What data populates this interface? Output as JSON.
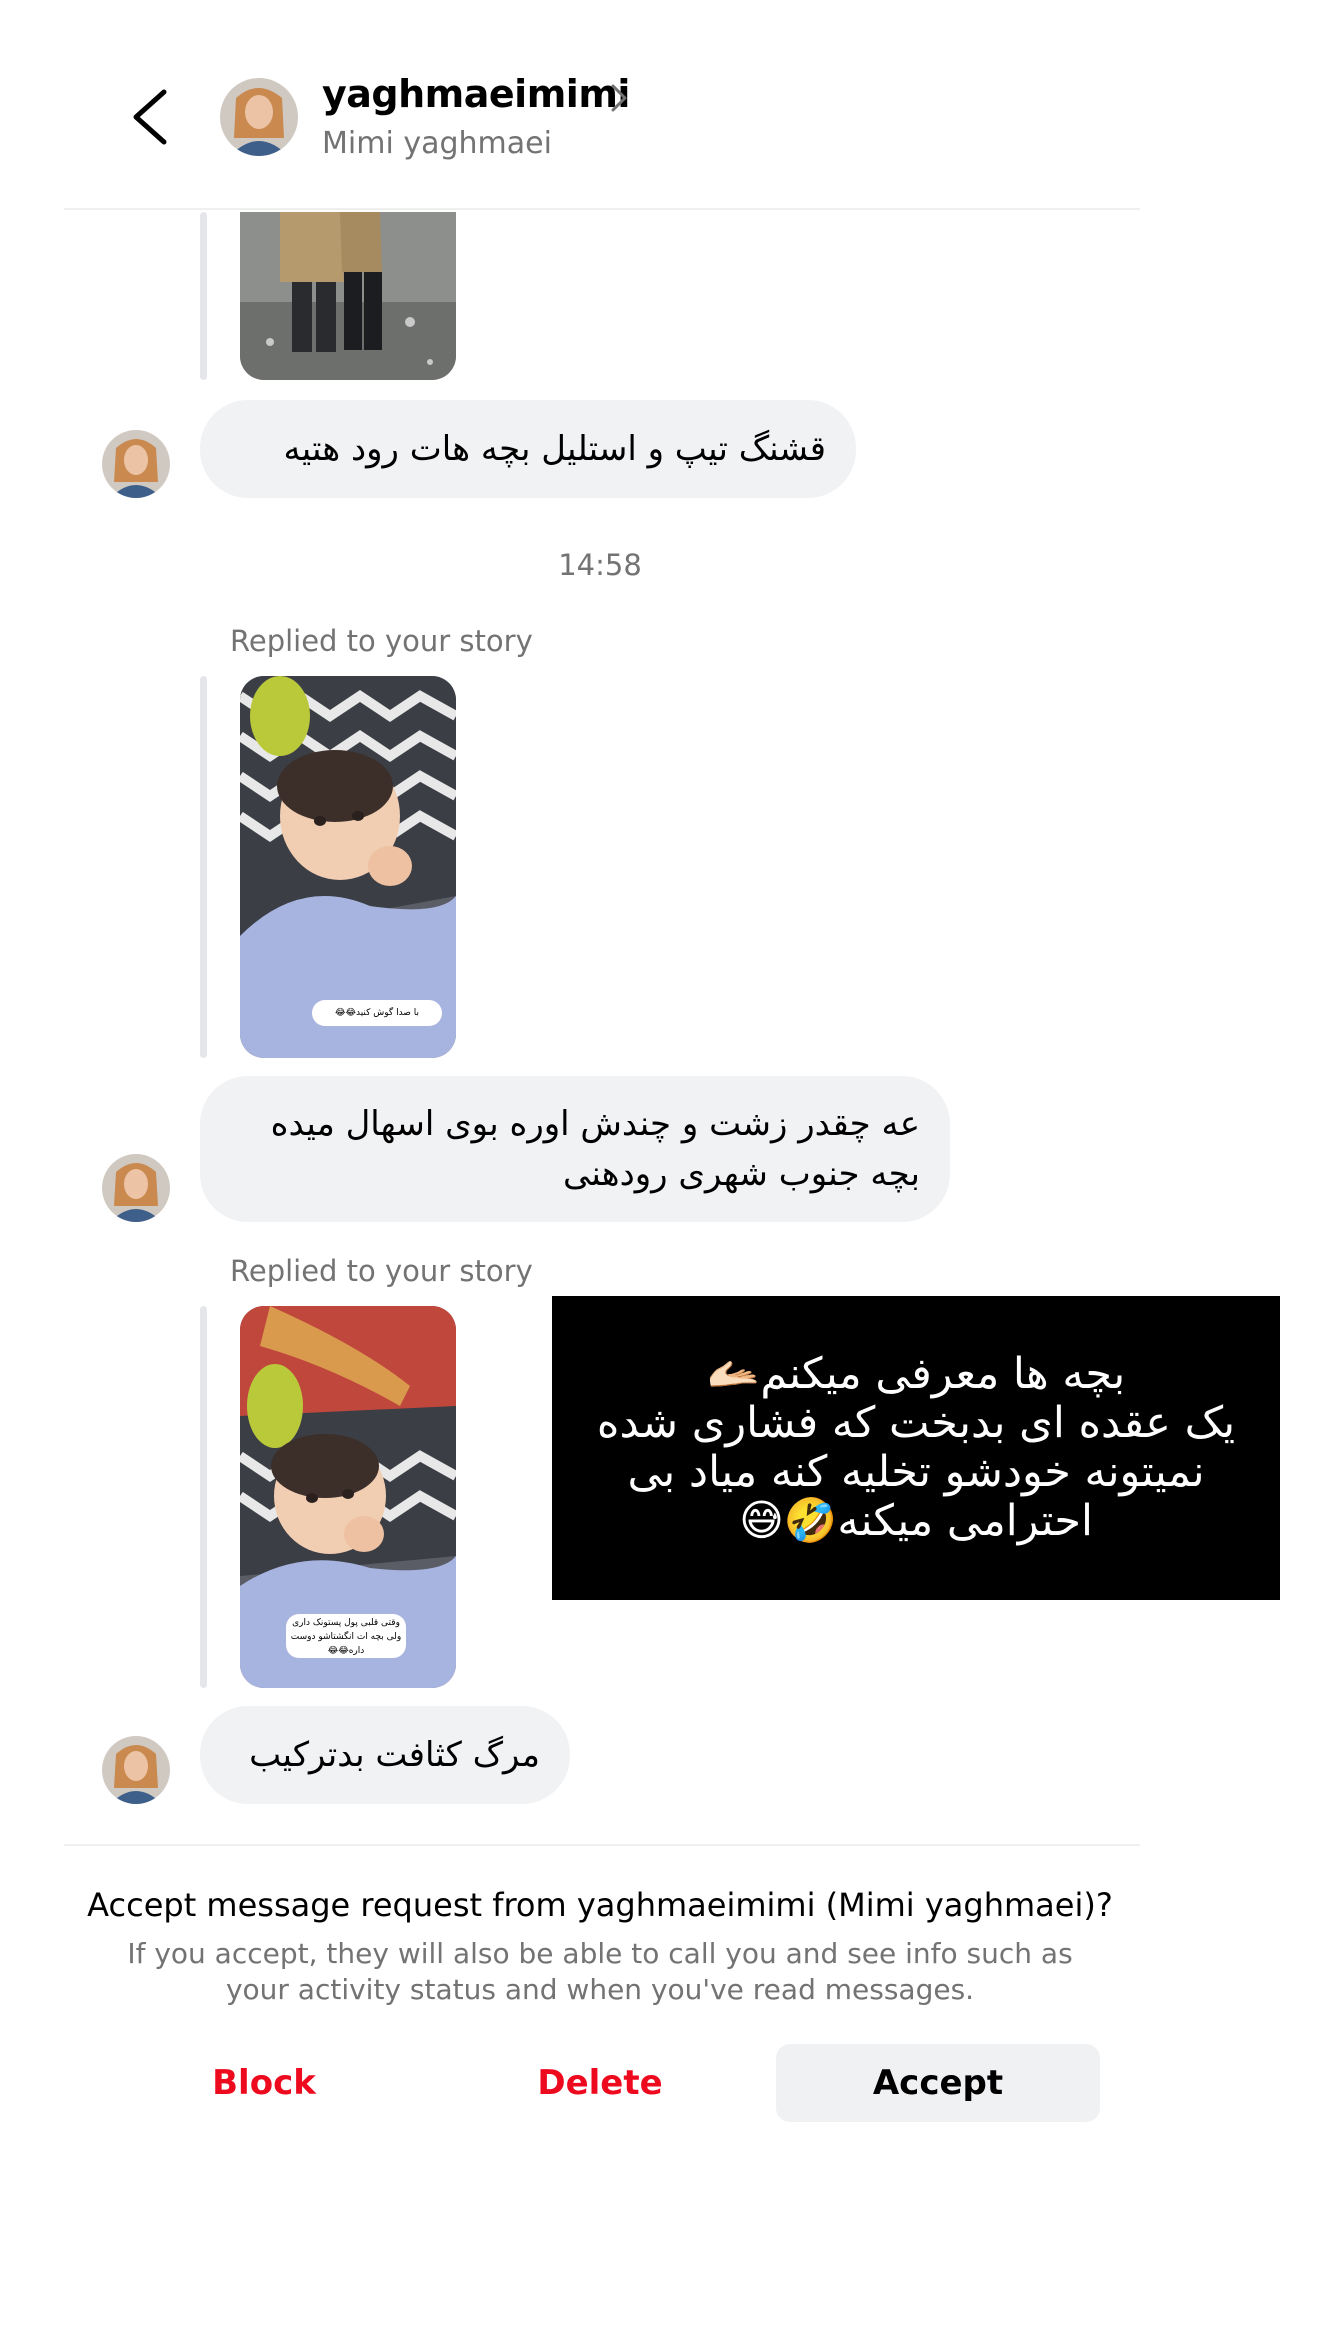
{
  "header": {
    "username": "yaghmaeimimi",
    "full_name": "Mimi yaghmaei"
  },
  "thread": {
    "message_1": "قشنگ تیپ و استلیل بچه هات رود هتیه",
    "timestamp": "14:58",
    "reply_1": {
      "label": "Replied to your story",
      "sticker": "با صدا گوش کنید😂😂",
      "message_line_1": "عه چقدر زشت و چندش اوره بوی اسهال میده",
      "message_line_2": "بچه جنوب شهری رودهنی"
    },
    "reply_2": {
      "label": "Replied to your story",
      "sticker": "وقتی قلبی پول پستونک داری ولی بچه ات انگشتاشو دوست داره😂😂",
      "message": "مرگ کثافت بدترکیب"
    },
    "overlay_caption": {
      "line_1": "بچه ها معرفی میکنم🫴🏻",
      "line_2": "یک عقده ای بدبخت که فشاری شده",
      "line_3": "نمیتونه خودشو تخلیه کنه میاد بی",
      "line_4": "احترامی میکنه🤣😅"
    }
  },
  "request": {
    "title": "Accept message request from yaghmaeimimi (Mimi yaghmaei)?",
    "description": "If you accept, they will also be able to call you and see info such as your activity status and when you've read messages.",
    "block_label": "Block",
    "delete_label": "Delete",
    "accept_label": "Accept"
  },
  "colors": {
    "danger": "#ed0a1e",
    "bubble": "#f1f2f4",
    "secondary_text": "#737373",
    "accept_bg": "#eff1f3"
  }
}
